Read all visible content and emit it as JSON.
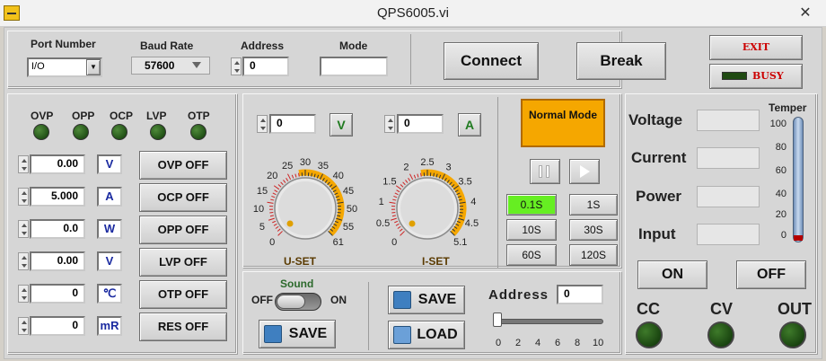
{
  "window": {
    "title": "QPS6005.vi",
    "close": "✕"
  },
  "port": {
    "label": "Port Number",
    "value": "I/O"
  },
  "baud": {
    "label": "Baud Rate",
    "value": "57600"
  },
  "address_top": {
    "label": "Address",
    "value": "0"
  },
  "mode_top": {
    "label": "Mode",
    "value": ""
  },
  "buttons": {
    "connect": "Connect",
    "break": "Break",
    "exit": "EXIT",
    "busy": "BUSY"
  },
  "protect": {
    "leds": [
      "OVP",
      "OPP",
      "OCP",
      "LVP",
      "OTP"
    ],
    "rows": [
      {
        "value": "0.00",
        "unit": "V",
        "button": "OVP OFF"
      },
      {
        "value": "5.000",
        "unit": "A",
        "button": "OCP OFF"
      },
      {
        "value": "0.0",
        "unit": "W",
        "button": "OPP OFF"
      },
      {
        "value": "0.00",
        "unit": "V",
        "button": "LVP OFF"
      },
      {
        "value": "0",
        "unit": "℃",
        "button": "OTP OFF"
      },
      {
        "value": "0",
        "unit": "mR",
        "button": "RES OFF"
      }
    ]
  },
  "uset": {
    "value": "0",
    "unit": "V",
    "label": "U-SET",
    "ticks": [
      "0",
      "5",
      "10",
      "15",
      "20",
      "25",
      "30",
      "35",
      "40",
      "45",
      "50",
      "55",
      "61"
    ],
    "knob_value": 0
  },
  "iset": {
    "value": "0",
    "unit": "A",
    "label": "I-SET",
    "ticks": [
      "0",
      "0.5",
      "1",
      "1.5",
      "2",
      "2.5",
      "3",
      "3.5",
      "4",
      "4.5",
      "5.1"
    ],
    "knob_value": 0
  },
  "sound": {
    "label": "Sound",
    "off": "OFF",
    "on": "ON",
    "save": "SAVE"
  },
  "memory": {
    "save": "SAVE",
    "load": "LOAD"
  },
  "address_slider": {
    "label": "Address",
    "value": "0",
    "ticks": [
      "0",
      "2",
      "4",
      "6",
      "8",
      "10"
    ]
  },
  "mode_button": "Normal Mode",
  "timer": {
    "active": "0.1S",
    "buttons": [
      "0.1S",
      "1S",
      "10S",
      "30S",
      "60S",
      "120S"
    ]
  },
  "readout": {
    "labels": [
      "Voltage",
      "Current",
      "Power",
      "Input"
    ],
    "values": [
      "",
      "",
      "",
      ""
    ]
  },
  "temper": {
    "label": "Temper",
    "ticks": [
      "100",
      "80",
      "60",
      "40",
      "20",
      "0"
    ],
    "level": 0
  },
  "output": {
    "on": "ON",
    "off": "OFF"
  },
  "indicators": {
    "labels": [
      "CC",
      "CV",
      "OUT"
    ]
  },
  "colors": {
    "accent": "#f5a700",
    "active_timer": "#66ee22",
    "unit_text": "#1a2aa0",
    "exit_text": "#cc0000"
  }
}
